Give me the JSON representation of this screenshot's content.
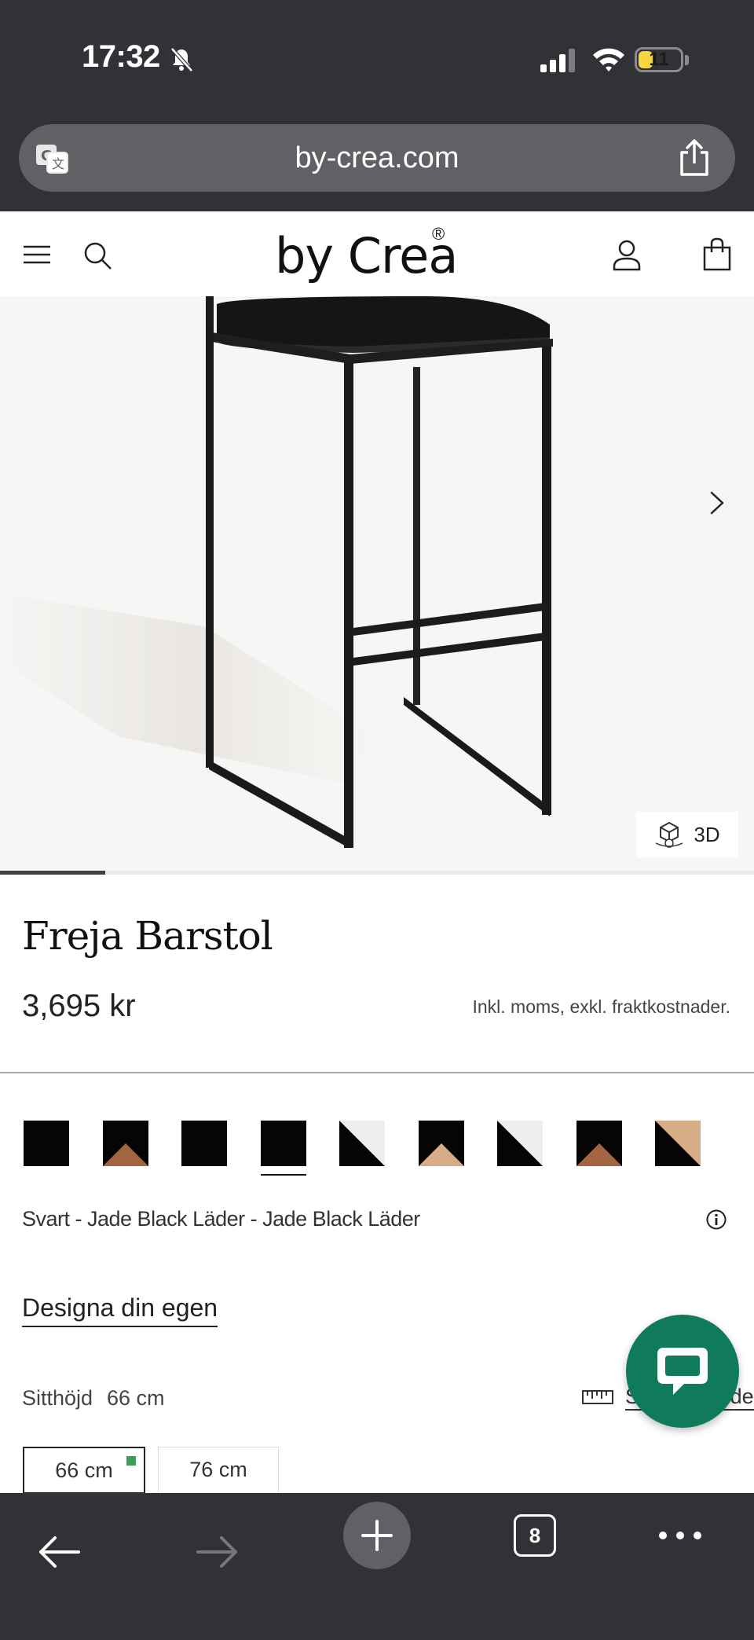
{
  "status_bar": {
    "time": "17:32",
    "battery_level": "11",
    "icons": [
      "bell-slash-icon",
      "cellular-signal-icon",
      "wifi-icon",
      "battery-icon"
    ]
  },
  "browser": {
    "url": "by-crea.com",
    "icons": [
      "translate-icon",
      "share-icon"
    ],
    "tab_count": "8",
    "toolbar_icons": [
      "back-arrow-icon",
      "forward-arrow-icon",
      "plus-icon",
      "tabs-icon",
      "more-icon"
    ]
  },
  "header": {
    "logo": "by Crea",
    "logo_mark": "®",
    "icons": [
      "menu-icon",
      "search-icon",
      "account-icon",
      "shopping-bag-icon"
    ]
  },
  "gallery": {
    "button_3d_label": "3D",
    "progress_fraction": 0.14,
    "icons": [
      "chevron-right-icon",
      "cube-3d-icon"
    ]
  },
  "product": {
    "title": "Freja Barstol",
    "price": "3,695 kr",
    "price_note": "Inkl. moms, exkl. fraktkostnader.",
    "swatches": [
      {
        "top": "#050505",
        "bottom": "#050505",
        "style": "solid"
      },
      {
        "top": "#050505",
        "bottom": "#a46640",
        "style": "triangle"
      },
      {
        "top": "#050505",
        "bottom": "#050505",
        "style": "solid"
      },
      {
        "top": "#050505",
        "bottom": "#050505",
        "style": "solid",
        "selected": true
      },
      {
        "top": "#eeeeec",
        "bottom": "#050505",
        "style": "diagonal"
      },
      {
        "top": "#050505",
        "bottom": "#d6ad86",
        "style": "triangle"
      },
      {
        "top": "#eeeeec",
        "bottom": "#050505",
        "style": "diagonal"
      },
      {
        "top": "#050505",
        "bottom": "#a46640",
        "style": "triangle"
      },
      {
        "top": "#d6ad86",
        "bottom": "#050505",
        "style": "diagonal"
      }
    ],
    "selected_color": "Svart - Jade Black Läder - Jade Black Läder",
    "design_link": "Designa din egen",
    "seat_height_label": "Sitthöjd",
    "seat_height_value": "66 cm",
    "size_guide_label": "Storleksguide",
    "sizes": [
      {
        "label": "66 cm",
        "selected": true,
        "in_stock": true
      },
      {
        "label": "76 cm",
        "selected": false
      }
    ]
  },
  "colors": {
    "brand_green": "#0f7a5c",
    "stock_green": "#3a9f5a",
    "chrome_dark": "#303236"
  }
}
